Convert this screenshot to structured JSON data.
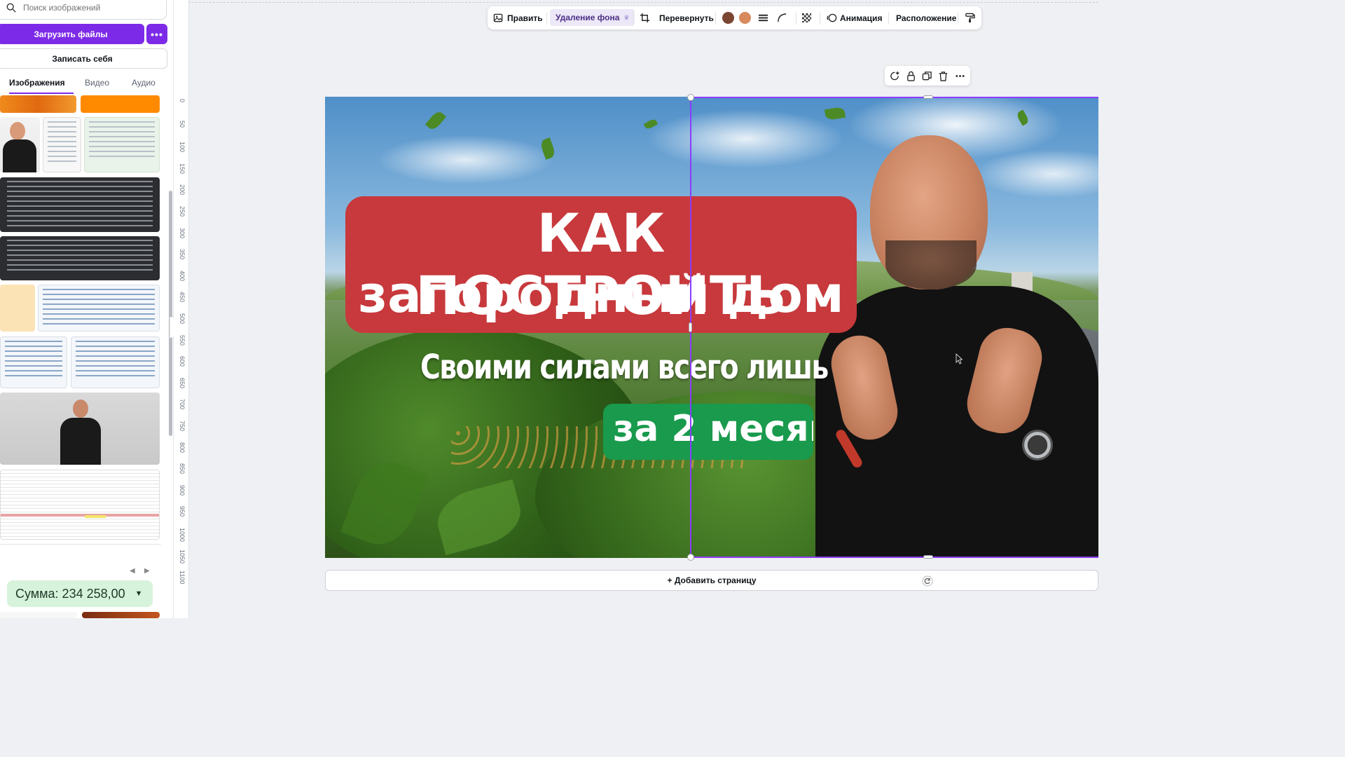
{
  "left_panel": {
    "search_placeholder": "Поиск изображений",
    "upload_label": "Загрузить файлы",
    "more_label": "•••",
    "record_label": "Записать себя",
    "tabs": [
      {
        "label": "Изображения",
        "active": true
      },
      {
        "label": "Видео",
        "active": false
      },
      {
        "label": "Аудио",
        "active": false
      }
    ],
    "sum_chip": "Сумма: 234 258,00"
  },
  "ruler": {
    "ticks": [
      "0",
      "50",
      "100",
      "150",
      "200",
      "250",
      "300",
      "350",
      "400",
      "450",
      "500",
      "550",
      "600",
      "650",
      "700",
      "750",
      "800",
      "850",
      "900",
      "950",
      "1000",
      "1050",
      "1100"
    ]
  },
  "toolbar": {
    "edit_label": "Править",
    "bg_remove_label": "Удаление фона",
    "flip_label": "Перевернуть",
    "animation_label": "Анимация",
    "position_label": "Расположение",
    "swatches": [
      "#7a4632",
      "#d88a5e"
    ]
  },
  "canvas": {
    "title_line1": "КАК ПОСТРОИТЬ",
    "title_line2": "загородный дом",
    "subtitle": "Своими силами всего лишь",
    "green_text": "за 2 месяц",
    "title_bg": "#c7393c",
    "green_bg": "#199a4d"
  },
  "add_page_label": "+ Добавить страницу",
  "accent": "#7d2ae8"
}
